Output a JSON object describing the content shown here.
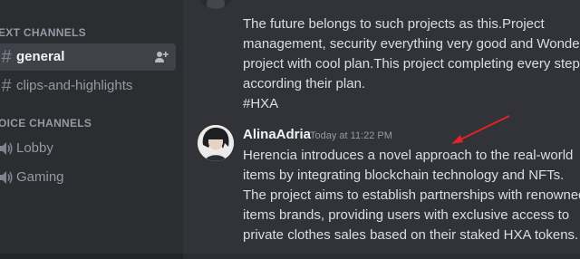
{
  "sidebar": {
    "categories": {
      "text": "EXT CHANNELS",
      "voice": "OICE CHANNELS"
    },
    "channels": [
      {
        "label": "general",
        "icon": "hash-icon",
        "active": true
      },
      {
        "label": "clips-and-highlights",
        "icon": "hash-icon",
        "active": false
      }
    ],
    "voice_channels": [
      {
        "label": "Lobby",
        "icon": "speaker-icon"
      },
      {
        "label": "Gaming",
        "icon": "speaker-icon"
      }
    ]
  },
  "messages": [
    {
      "lines": [
        "The future belongs to such projects as this.Project",
        "management, security everything very good and Wonderful",
        "project with cool plan.This project completing every step",
        "according their plan.",
        "#HXA"
      ]
    },
    {
      "author": "AlinaAdria",
      "timestamp": "Today at 11:22 PM",
      "lines": [
        "Herencia introduces a novel approach to the real-world",
        "items by integrating blockchain technology and NFTs.",
        "The project aims to establish partnerships with renowned",
        "items brands, providing users with exclusive access to",
        "private clothes sales based on their staked HXA tokens."
      ]
    }
  ],
  "colors": {
    "annotation_arrow": "#e02424",
    "sidebar_bg": "#2b2d31",
    "chat_bg": "#313338"
  }
}
